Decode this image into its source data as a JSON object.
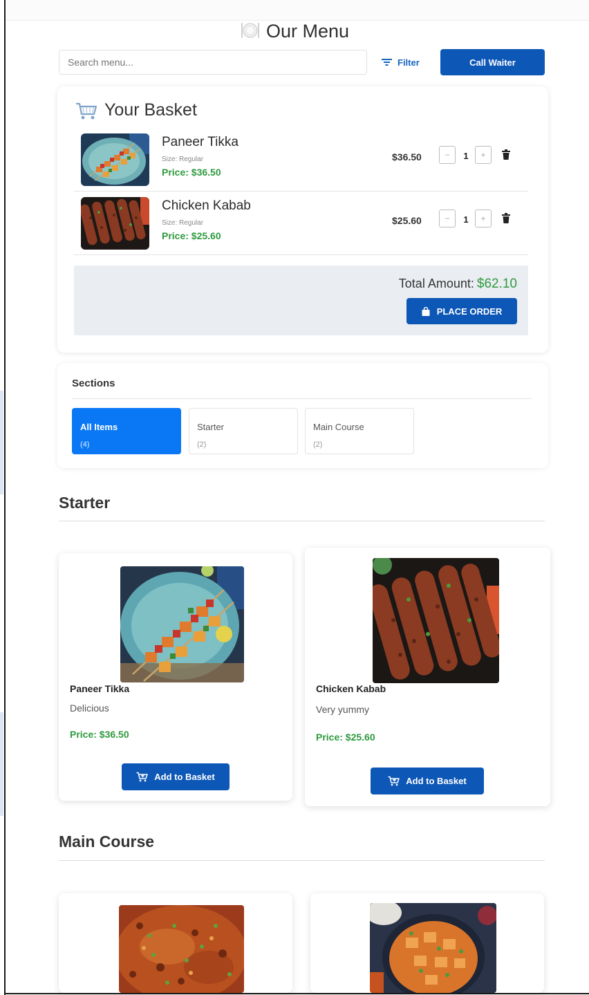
{
  "header": {
    "title": "Our Menu",
    "title_icon": "plate-cutlery-icon"
  },
  "toolbar": {
    "search_placeholder": "Search menu...",
    "filter_label": "Filter",
    "call_waiter_label": "Call Waiter"
  },
  "basket": {
    "title": "Your Basket",
    "items": [
      {
        "name": "Paneer Tikka",
        "size": "Size: Regular",
        "price": "Price: $36.50",
        "line_total": "$36.50",
        "qty": "1",
        "minus": "−",
        "plus": "+",
        "image": "paneer-tikka-skewers"
      },
      {
        "name": "Chicken Kabab",
        "size": "Size: Regular",
        "price": "Price: $25.60",
        "line_total": "$25.60",
        "qty": "1",
        "minus": "−",
        "plus": "+",
        "image": "chicken-kabab"
      }
    ],
    "total_label": "Total Amount:",
    "total_value": "$62.10",
    "place_order_label": "PLACE ORDER"
  },
  "sections": {
    "title": "Sections",
    "tabs": [
      {
        "label": "All Items",
        "count": "(4)",
        "active": true
      },
      {
        "label": "Starter",
        "count": "(2)",
        "active": false
      },
      {
        "label": "Main Course",
        "count": "(2)",
        "active": false
      }
    ]
  },
  "menu": {
    "starter": {
      "heading": "Starter",
      "items": [
        {
          "name": "Paneer Tikka",
          "description": "Delicious",
          "price": "Price: $36.50",
          "button": "Add to Basket"
        },
        {
          "name": "Chicken Kabab",
          "description": "Very yummy",
          "price": "Price: $25.60",
          "button": "Add to Basket"
        }
      ]
    },
    "main_course": {
      "heading": "Main Course",
      "items": [
        {
          "image": "butter-masala-curry"
        },
        {
          "image": "paneer-curry-bowl"
        }
      ]
    }
  },
  "colors": {
    "primary": "#0d57b7",
    "active_tab": "#0a78f5",
    "price_green": "#2e9a3e",
    "total_panel": "#eaedf2"
  }
}
